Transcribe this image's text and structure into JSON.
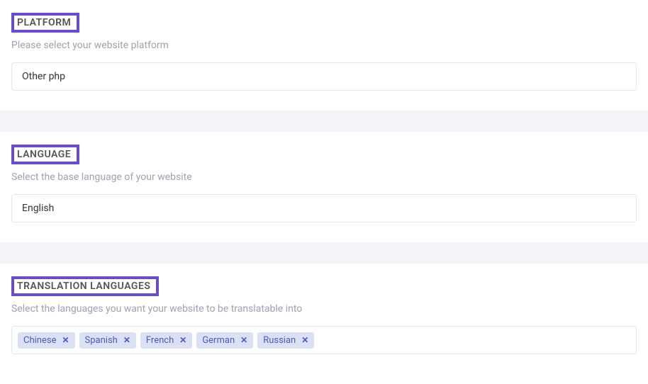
{
  "platform": {
    "heading": "PLATFORM",
    "subheading": "Please select your website platform",
    "value": "Other php"
  },
  "language": {
    "heading": "LANGUAGE",
    "subheading": "Select the base language of your website",
    "value": "English"
  },
  "translation": {
    "heading": "TRANSLATION LANGUAGES",
    "subheading": "Select the languages you want your website to be translatable into",
    "tags": [
      "Chinese",
      "Spanish",
      "French",
      "German",
      "Russian"
    ]
  }
}
